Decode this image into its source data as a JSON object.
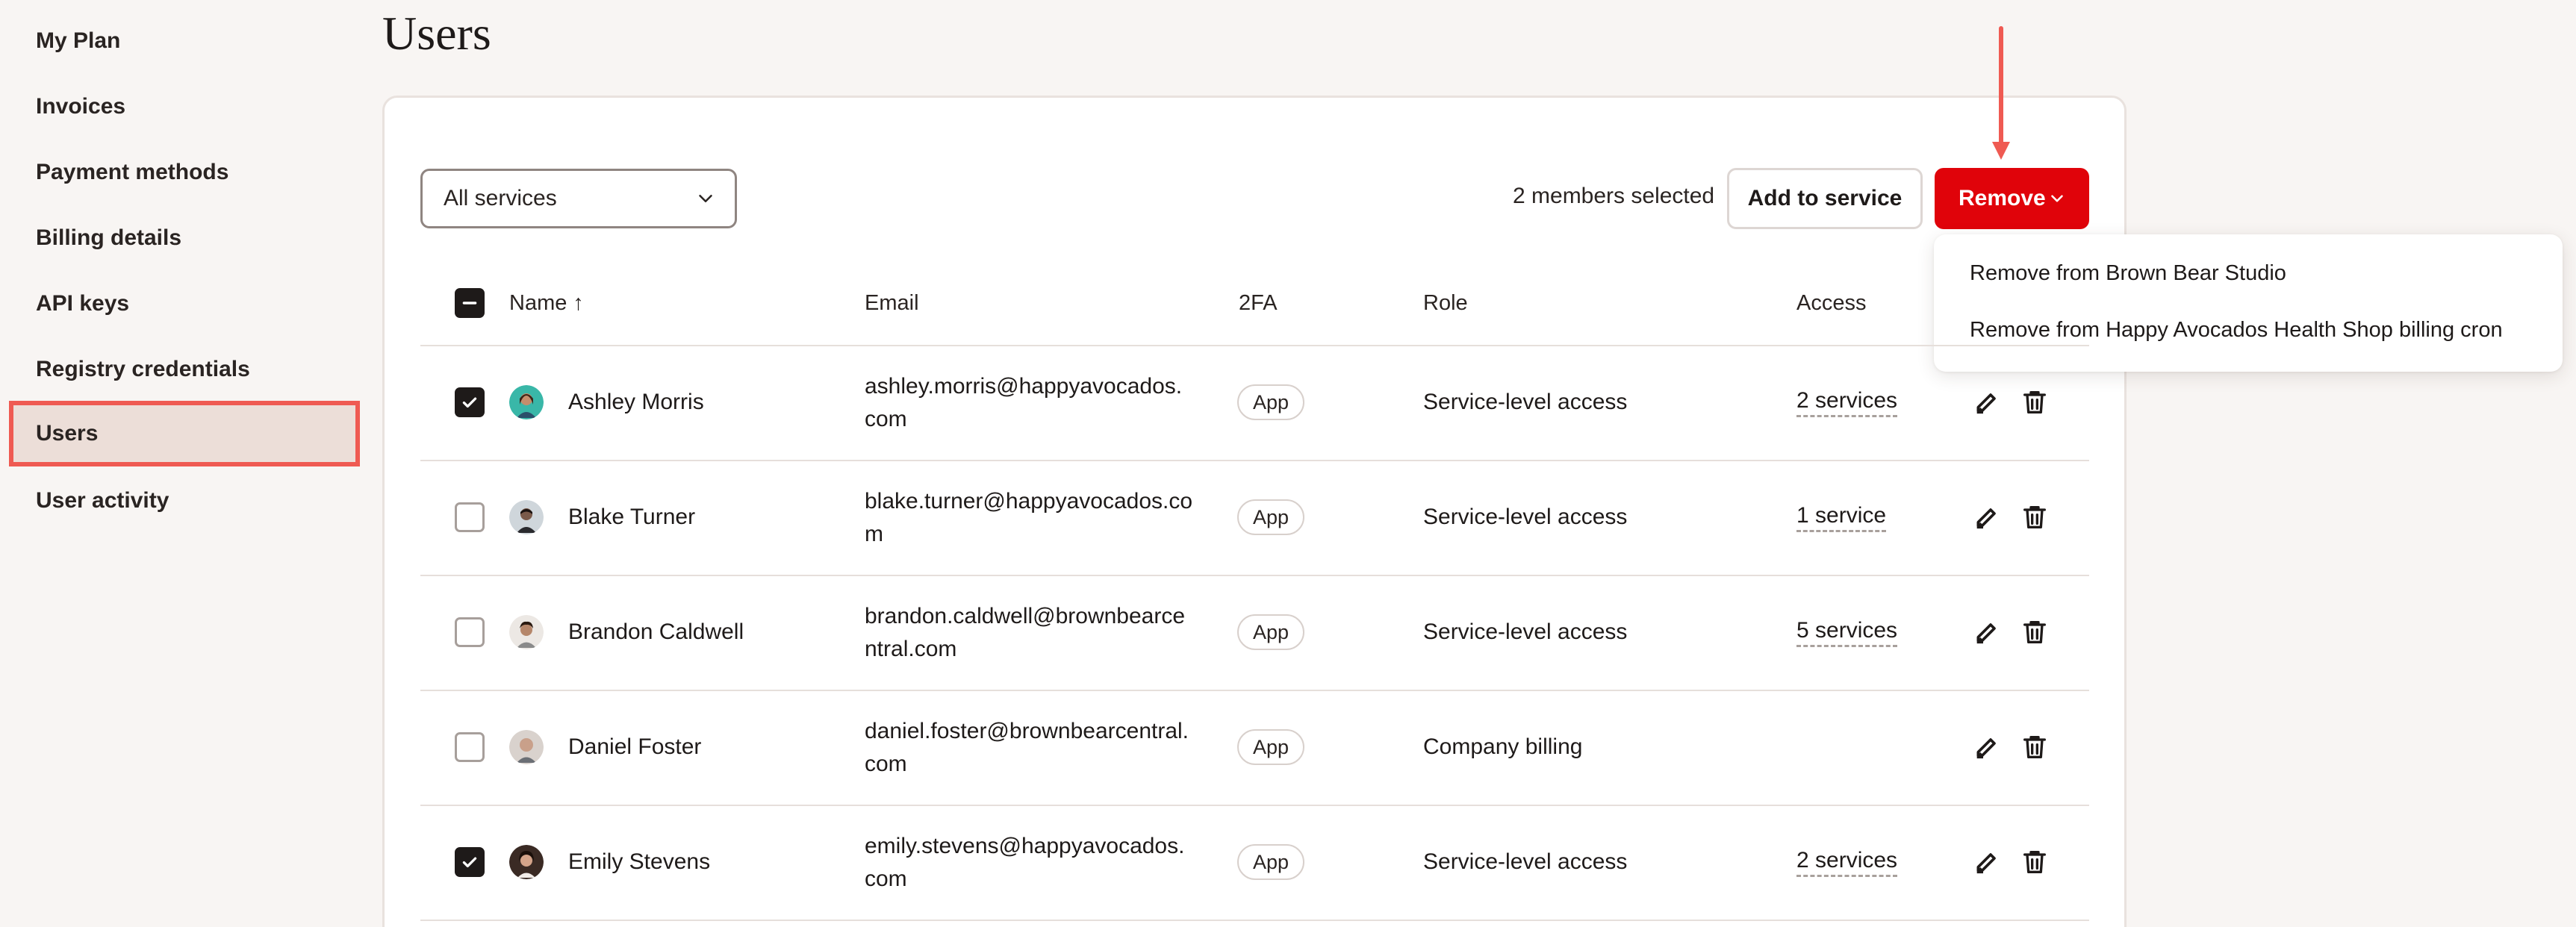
{
  "sidebar": {
    "items": [
      {
        "label": "My Plan"
      },
      {
        "label": "Invoices"
      },
      {
        "label": "Payment methods"
      },
      {
        "label": "Billing details"
      },
      {
        "label": "API keys"
      },
      {
        "label": "Registry credentials"
      },
      {
        "label": "Users",
        "active": true
      },
      {
        "label": "User activity"
      }
    ]
  },
  "page": {
    "title": "Users"
  },
  "toolbar": {
    "filter_value": "All services",
    "selected_count": "2 members selected",
    "add_label": "Add to service",
    "remove_label": "Remove"
  },
  "remove_menu": {
    "items": [
      "Remove from Brown Bear Studio",
      "Remove from Happy Avocados Health Shop billing cron"
    ]
  },
  "table": {
    "headers": {
      "name": "Name ↑",
      "email": "Email",
      "tfa": "2FA",
      "role": "Role",
      "access": "Access"
    },
    "rows": [
      {
        "name": "Ashley Morris",
        "email": "ashley.morris@happyavocados.com",
        "tfa": "App",
        "role": "Service-level access",
        "access": "2 services",
        "checked": true
      },
      {
        "name": "Blake Turner",
        "email": "blake.turner@happyavocados.com",
        "tfa": "App",
        "role": "Service-level access",
        "access": "1 service",
        "checked": false
      },
      {
        "name": "Brandon Caldwell",
        "email": "brandon.caldwell@brownbearcentral.com",
        "tfa": "App",
        "role": "Service-level access",
        "access": "5 services",
        "checked": false
      },
      {
        "name": "Daniel Foster",
        "email": "daniel.foster@brownbearcentral.com",
        "tfa": "App",
        "role": "Company billing",
        "access": "",
        "checked": false
      },
      {
        "name": "Emily Stevens",
        "email": "emily.stevens@happyavocados.com",
        "tfa": "App",
        "role": "Service-level access",
        "access": "2 services",
        "checked": true
      }
    ]
  },
  "colors": {
    "accent": "#e0030a",
    "highlight": "#ef5a52",
    "background": "#f8f5f3"
  }
}
